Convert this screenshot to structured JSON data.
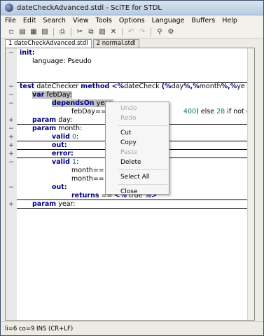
{
  "window": {
    "title": "dateCheckAdvanced.stdl - SciTE for STDL"
  },
  "menubar": [
    "File",
    "Edit",
    "Search",
    "View",
    "Tools",
    "Options",
    "Language",
    "Buffers",
    "Help"
  ],
  "toolbar": [
    "new-icon",
    "open-icon",
    "save-icon",
    "close-file-icon",
    "print-icon",
    "cut-icon",
    "copy-icon",
    "paste-icon",
    "delete-icon",
    "undo-icon",
    "redo-icon",
    "find-icon",
    "replace-icon"
  ],
  "tabs": [
    {
      "label": "1 dateCheckAdvanced.stdl"
    },
    {
      "label": "2 normal.stdl"
    }
  ],
  "code": {
    "l1_kw": "init:",
    "l2": "language: Pseudo",
    "l3_kw1": "test",
    "l3_id1": " dateChecker ",
    "l3_kw2": "method <%",
    "l3_id2": "dateCheck ",
    "l3_kw3": "(%",
    "l3_id3": "day",
    "l3_kw4": "%,%",
    "l3_id4": "month",
    "l3_kw5": "%,%",
    "l3_id5": "ye",
    "l4_kw": "var",
    "l4_id": " febDay:",
    "l5_kw": "dependsOn",
    "l5_id": " year:",
    "l6_id1": "febDay==",
    "l6_num1": "400",
    "l6_id2": ") else ",
    "l6_num2": "28",
    "l6_id3": " if not (year",
    "l7_kw": "param",
    "l7_id": " day:",
    "l8_kw": "param",
    "l8_id": " month:",
    "l9_kw": "valid",
    "l9_num": " 0",
    "l9_id": ":",
    "l10_kw": "out:",
    "l11_kw": "error:",
    "l12_kw": "valid",
    "l12_num": " 1",
    "l12_id": ":",
    "l13_id": "month==",
    "l14_id": "month==",
    "l15_kw": "out:",
    "l16_kw": "returns",
    "l16_id": " == ",
    "l16_kw2": "<%",
    "l16_id2": " true ",
    "l16_kw3": "%>",
    "l17_kw": "param",
    "l17_id": " year:"
  },
  "context_menu": {
    "undo": "Undo",
    "redo": "Redo",
    "cut": "Cut",
    "copy": "Copy",
    "paste": "Paste",
    "delete": "Delete",
    "select_all": "Select All",
    "close": "Close"
  },
  "status": "li=6 co=9 INS (CR+LF)"
}
